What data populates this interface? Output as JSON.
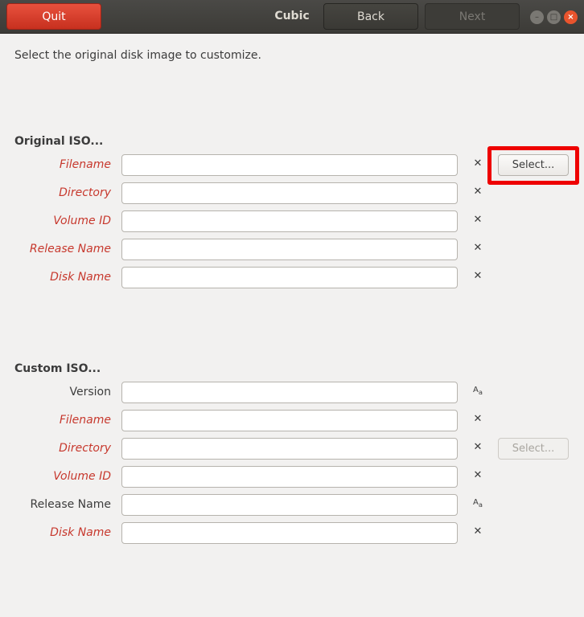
{
  "header": {
    "quit_label": "Quit",
    "title": "Cubic",
    "back_label": "Back",
    "next_label": "Next"
  },
  "instruction": "Select the original disk image to customize.",
  "original": {
    "title": "Original ISO...",
    "select_label": "Select...",
    "fields": {
      "filename": {
        "label": "Filename",
        "value": ""
      },
      "directory": {
        "label": "Directory",
        "value": ""
      },
      "volume_id": {
        "label": "Volume ID",
        "value": ""
      },
      "release_name": {
        "label": "Release Name",
        "value": ""
      },
      "disk_name": {
        "label": "Disk Name",
        "value": ""
      }
    }
  },
  "custom": {
    "title": "Custom ISO...",
    "select_label": "Select...",
    "fields": {
      "version": {
        "label": "Version",
        "value": ""
      },
      "filename": {
        "label": "Filename",
        "value": ""
      },
      "directory": {
        "label": "Directory",
        "value": ""
      },
      "volume_id": {
        "label": "Volume ID",
        "value": ""
      },
      "release_name": {
        "label": "Release Name",
        "value": ""
      },
      "disk_name": {
        "label": "Disk Name",
        "value": ""
      }
    }
  },
  "icons": {
    "clear": "close-x-icon",
    "auto_text": "text-case-icon"
  },
  "colors": {
    "accent": "#e8513e",
    "required_label": "#c7382d",
    "highlight": "#ee0000"
  }
}
